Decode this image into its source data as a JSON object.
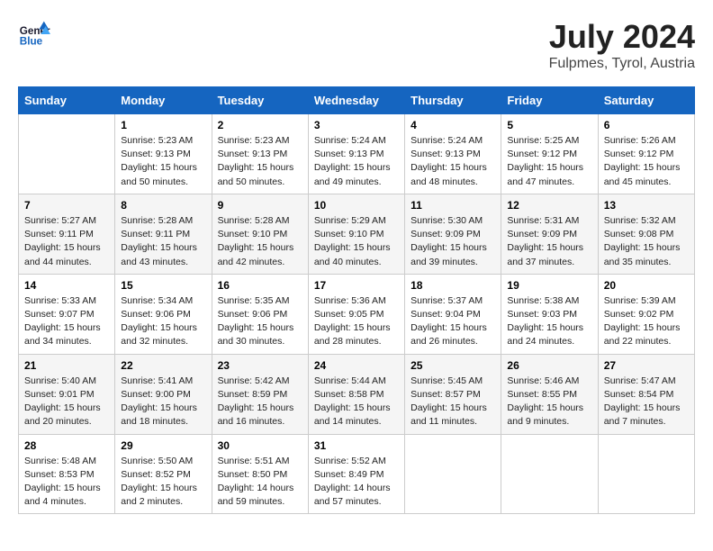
{
  "header": {
    "logo_line1": "General",
    "logo_line2": "Blue",
    "month": "July 2024",
    "location": "Fulpmes, Tyrol, Austria"
  },
  "days_of_week": [
    "Sunday",
    "Monday",
    "Tuesday",
    "Wednesday",
    "Thursday",
    "Friday",
    "Saturday"
  ],
  "weeks": [
    [
      {
        "day": "",
        "text": ""
      },
      {
        "day": "1",
        "text": "Sunrise: 5:23 AM\nSunset: 9:13 PM\nDaylight: 15 hours\nand 50 minutes."
      },
      {
        "day": "2",
        "text": "Sunrise: 5:23 AM\nSunset: 9:13 PM\nDaylight: 15 hours\nand 50 minutes."
      },
      {
        "day": "3",
        "text": "Sunrise: 5:24 AM\nSunset: 9:13 PM\nDaylight: 15 hours\nand 49 minutes."
      },
      {
        "day": "4",
        "text": "Sunrise: 5:24 AM\nSunset: 9:13 PM\nDaylight: 15 hours\nand 48 minutes."
      },
      {
        "day": "5",
        "text": "Sunrise: 5:25 AM\nSunset: 9:12 PM\nDaylight: 15 hours\nand 47 minutes."
      },
      {
        "day": "6",
        "text": "Sunrise: 5:26 AM\nSunset: 9:12 PM\nDaylight: 15 hours\nand 45 minutes."
      }
    ],
    [
      {
        "day": "7",
        "text": "Sunrise: 5:27 AM\nSunset: 9:11 PM\nDaylight: 15 hours\nand 44 minutes."
      },
      {
        "day": "8",
        "text": "Sunrise: 5:28 AM\nSunset: 9:11 PM\nDaylight: 15 hours\nand 43 minutes."
      },
      {
        "day": "9",
        "text": "Sunrise: 5:28 AM\nSunset: 9:10 PM\nDaylight: 15 hours\nand 42 minutes."
      },
      {
        "day": "10",
        "text": "Sunrise: 5:29 AM\nSunset: 9:10 PM\nDaylight: 15 hours\nand 40 minutes."
      },
      {
        "day": "11",
        "text": "Sunrise: 5:30 AM\nSunset: 9:09 PM\nDaylight: 15 hours\nand 39 minutes."
      },
      {
        "day": "12",
        "text": "Sunrise: 5:31 AM\nSunset: 9:09 PM\nDaylight: 15 hours\nand 37 minutes."
      },
      {
        "day": "13",
        "text": "Sunrise: 5:32 AM\nSunset: 9:08 PM\nDaylight: 15 hours\nand 35 minutes."
      }
    ],
    [
      {
        "day": "14",
        "text": "Sunrise: 5:33 AM\nSunset: 9:07 PM\nDaylight: 15 hours\nand 34 minutes."
      },
      {
        "day": "15",
        "text": "Sunrise: 5:34 AM\nSunset: 9:06 PM\nDaylight: 15 hours\nand 32 minutes."
      },
      {
        "day": "16",
        "text": "Sunrise: 5:35 AM\nSunset: 9:06 PM\nDaylight: 15 hours\nand 30 minutes."
      },
      {
        "day": "17",
        "text": "Sunrise: 5:36 AM\nSunset: 9:05 PM\nDaylight: 15 hours\nand 28 minutes."
      },
      {
        "day": "18",
        "text": "Sunrise: 5:37 AM\nSunset: 9:04 PM\nDaylight: 15 hours\nand 26 minutes."
      },
      {
        "day": "19",
        "text": "Sunrise: 5:38 AM\nSunset: 9:03 PM\nDaylight: 15 hours\nand 24 minutes."
      },
      {
        "day": "20",
        "text": "Sunrise: 5:39 AM\nSunset: 9:02 PM\nDaylight: 15 hours\nand 22 minutes."
      }
    ],
    [
      {
        "day": "21",
        "text": "Sunrise: 5:40 AM\nSunset: 9:01 PM\nDaylight: 15 hours\nand 20 minutes."
      },
      {
        "day": "22",
        "text": "Sunrise: 5:41 AM\nSunset: 9:00 PM\nDaylight: 15 hours\nand 18 minutes."
      },
      {
        "day": "23",
        "text": "Sunrise: 5:42 AM\nSunset: 8:59 PM\nDaylight: 15 hours\nand 16 minutes."
      },
      {
        "day": "24",
        "text": "Sunrise: 5:44 AM\nSunset: 8:58 PM\nDaylight: 15 hours\nand 14 minutes."
      },
      {
        "day": "25",
        "text": "Sunrise: 5:45 AM\nSunset: 8:57 PM\nDaylight: 15 hours\nand 11 minutes."
      },
      {
        "day": "26",
        "text": "Sunrise: 5:46 AM\nSunset: 8:55 PM\nDaylight: 15 hours\nand 9 minutes."
      },
      {
        "day": "27",
        "text": "Sunrise: 5:47 AM\nSunset: 8:54 PM\nDaylight: 15 hours\nand 7 minutes."
      }
    ],
    [
      {
        "day": "28",
        "text": "Sunrise: 5:48 AM\nSunset: 8:53 PM\nDaylight: 15 hours\nand 4 minutes."
      },
      {
        "day": "29",
        "text": "Sunrise: 5:50 AM\nSunset: 8:52 PM\nDaylight: 15 hours\nand 2 minutes."
      },
      {
        "day": "30",
        "text": "Sunrise: 5:51 AM\nSunset: 8:50 PM\nDaylight: 14 hours\nand 59 minutes."
      },
      {
        "day": "31",
        "text": "Sunrise: 5:52 AM\nSunset: 8:49 PM\nDaylight: 14 hours\nand 57 minutes."
      },
      {
        "day": "",
        "text": ""
      },
      {
        "day": "",
        "text": ""
      },
      {
        "day": "",
        "text": ""
      }
    ]
  ]
}
